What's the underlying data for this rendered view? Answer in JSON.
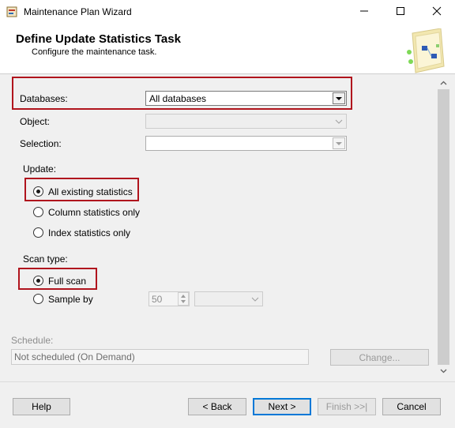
{
  "window": {
    "title": "Maintenance Plan Wizard",
    "minimize_glyph": "—",
    "maximize_glyph": "☐",
    "close_glyph": "✕"
  },
  "header": {
    "title": "Define Update Statistics Task",
    "subtitle": "Configure the maintenance task."
  },
  "form": {
    "databases_label": "Databases:",
    "databases_value": "All databases",
    "object_label": "Object:",
    "object_value": "",
    "selection_label": "Selection:",
    "selection_value": "",
    "update_label": "Update:",
    "update_options": [
      {
        "label": "All existing statistics",
        "checked": true
      },
      {
        "label": "Column statistics only",
        "checked": false
      },
      {
        "label": "Index statistics only",
        "checked": false
      }
    ],
    "scan_type_label": "Scan type:",
    "scan_options": [
      {
        "label": "Full scan",
        "checked": true
      },
      {
        "label": "Sample by",
        "checked": false
      }
    ],
    "sample_value": "50",
    "sample_unit_value": "",
    "schedule_label": "Schedule:",
    "schedule_value": "Not scheduled (On Demand)",
    "change_button": "Change..."
  },
  "footer": {
    "help": "Help",
    "back": "< Back",
    "next": "Next >",
    "finish": "Finish >>|",
    "cancel": "Cancel"
  },
  "colors": {
    "highlight": "#b0141d",
    "default_button_border": "#0078d7"
  },
  "icons": [
    "app-icon",
    "minimize-icon",
    "maximize-icon",
    "close-icon",
    "dropdown-arrow-icon",
    "wizard-graphic-icon",
    "scroll-up-icon",
    "scroll-down-icon"
  ]
}
